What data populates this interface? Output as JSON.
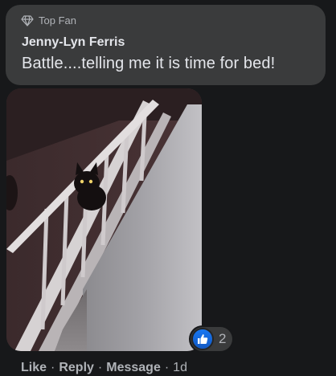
{
  "comment": {
    "badge": "Top Fan",
    "author": "Jenny-Lyn Ferris",
    "text": "Battle....telling me it is time for bed!",
    "reaction_count": "2",
    "actions": {
      "like": "Like",
      "reply": "Reply",
      "message": "Message",
      "separator": "·",
      "timestamp": "1d"
    }
  },
  "icons": {
    "badge_icon": "diamond-icon",
    "reaction_icon": "thumbs-up-icon"
  },
  "colors": {
    "background": "#17181a",
    "bubble": "#3a3b3c",
    "primary_text": "#e4e6eb",
    "secondary_text": "#b0b3b8",
    "like_blue": "#1877f2"
  }
}
